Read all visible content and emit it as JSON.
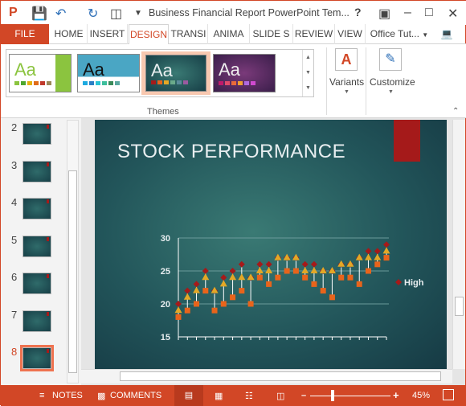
{
  "window": {
    "title": "Business Financial Report PowerPoint Tem...",
    "help": "?",
    "user": "Office Tut..."
  },
  "tabs": [
    "FILE",
    "HOME",
    "INSERT",
    "DESIGN",
    "TRANSI",
    "ANIMA",
    "SLIDE S",
    "REVIEW",
    "VIEW"
  ],
  "active_tab": "DESIGN",
  "ribbon": {
    "themes_label": "Themes",
    "variants": "Variants",
    "customize": "Customize",
    "theme_sample": "Aa"
  },
  "slides": {
    "numbers": [
      "2",
      "3",
      "4",
      "5",
      "6",
      "7",
      "8"
    ],
    "selected": "8"
  },
  "slide": {
    "title": "STOCK PERFORMANCE"
  },
  "chart_data": {
    "type": "stock",
    "ylim": [
      15,
      30
    ],
    "yticks": [
      15,
      20,
      25,
      30
    ],
    "grid": true,
    "legend": [
      "High"
    ],
    "legend_placement": "right",
    "high": [
      20,
      22,
      23,
      25,
      22,
      24,
      25,
      26,
      24,
      26,
      26,
      27,
      27,
      27,
      26,
      26,
      25,
      25,
      26,
      26,
      27,
      28,
      28,
      29
    ],
    "close": [
      19,
      21,
      22,
      24,
      22,
      23,
      24,
      24,
      24,
      25,
      25,
      27,
      27,
      27,
      25,
      25,
      25,
      25,
      26,
      26,
      27,
      27,
      27,
      28
    ],
    "low": [
      18,
      19,
      20,
      22,
      19,
      20,
      21,
      22,
      20,
      24,
      23,
      24,
      25,
      25,
      24,
      23,
      22,
      21,
      24,
      24,
      23,
      25,
      26,
      27
    ],
    "colors": {
      "high": "#a51a1a",
      "close": "#e3a826",
      "low": "#e8641b"
    }
  },
  "status": {
    "notes": "NOTES",
    "comments": "COMMENTS",
    "zoom": "45%",
    "zoom_fraction": 0.28
  },
  "accent": "#d24726"
}
